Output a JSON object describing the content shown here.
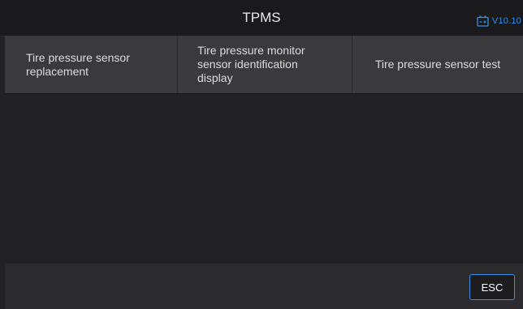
{
  "header": {
    "title": "TPMS",
    "version": "V10.10",
    "version_icon": "battery-icon",
    "accent_color": "#3a8ee6"
  },
  "menu": {
    "items": [
      {
        "label": "Tire pressure sensor replacement"
      },
      {
        "label": "Tire pressure monitor sensor identification display"
      },
      {
        "label": "Tire pressure sensor test"
      }
    ]
  },
  "footer": {
    "esc_label": "ESC"
  }
}
